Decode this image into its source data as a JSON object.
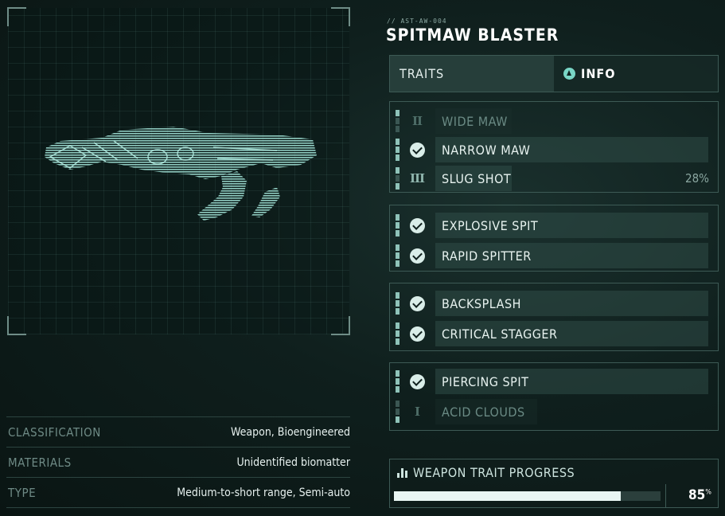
{
  "weapon": {
    "id": "// AST-AW-004",
    "name": "SPITMAW BLASTER"
  },
  "tabs": {
    "traits": "TRAITS",
    "info": "INFO",
    "info_icon": "triangle-button-icon"
  },
  "traits": {
    "group1": [
      {
        "label": "WIDE MAW",
        "icon": "roman-two-icon",
        "glyph": "II",
        "state": "locked"
      },
      {
        "label": "NARROW MAW",
        "icon": "check-icon",
        "state": "unlocked"
      },
      {
        "label": "SLUG SHOT",
        "icon": "roman-three-icon",
        "glyph": "III",
        "state": "in-progress",
        "progress": "28%"
      }
    ],
    "group2": [
      {
        "label": "EXPLOSIVE SPIT",
        "icon": "check-icon",
        "state": "unlocked"
      },
      {
        "label": "RAPID SPITTER",
        "icon": "check-icon",
        "state": "unlocked"
      }
    ],
    "group3": [
      {
        "label": "BACKSPLASH",
        "icon": "check-icon",
        "state": "unlocked"
      },
      {
        "label": "CRITICAL STAGGER",
        "icon": "check-icon",
        "state": "unlocked"
      }
    ],
    "group4": [
      {
        "label": "PIERCING SPIT",
        "icon": "check-icon",
        "state": "unlocked"
      },
      {
        "label": "ACID CLOUDS",
        "icon": "roman-one-icon",
        "glyph": "I",
        "state": "locked"
      }
    ]
  },
  "details": [
    {
      "label": "CLASSIFICATION",
      "value": "Weapon, Bioengineered"
    },
    {
      "label": "MATERIALS",
      "value": "Unidentified biomatter"
    },
    {
      "label": "TYPE",
      "value": "Medium-to-short range, Semi-auto"
    }
  ],
  "progress": {
    "title": "WEAPON TRAIT PROGRESS",
    "icon": "bar-chart-icon",
    "value": 85,
    "value_text": "85",
    "unit": "%"
  },
  "colors": {
    "accent": "#79d6c6",
    "text": "#e6f0ee",
    "panel_border": "#3d5a55",
    "progress_fill": "#e9f6f3"
  }
}
